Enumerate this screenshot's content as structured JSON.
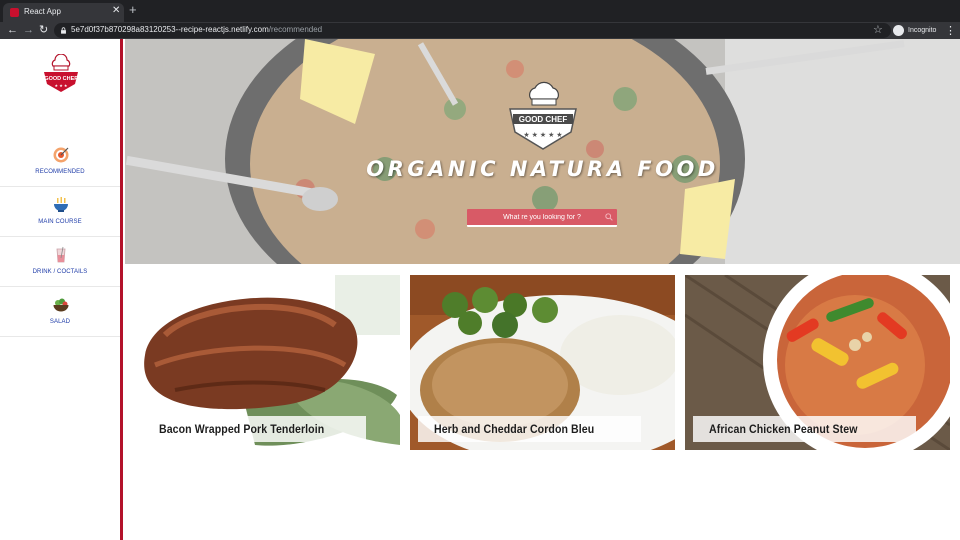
{
  "browser": {
    "tab_title": "React App",
    "tab_close": "✕",
    "new_tab": "+",
    "back": "←",
    "forward": "→",
    "reload": "↻",
    "url_host": "5e7d0f37b870298a83120253--recipe-reactjs.netlify.com",
    "url_path": "/recommended",
    "bookmark": "☆",
    "profile_label": "Incognito",
    "menu": "⋮"
  },
  "sidebar": {
    "logo_text": "GOOD CHEF",
    "items": [
      {
        "label": "RECOMMENDED",
        "icon": "target-icon"
      },
      {
        "label": "MAIN COURSE",
        "icon": "bowl-icon"
      },
      {
        "label": "DRINK / COCTAILS",
        "icon": "drink-icon"
      },
      {
        "label": "SALAD",
        "icon": "salad-icon"
      }
    ]
  },
  "hero": {
    "logo_text": "GOOD CHEF",
    "title": "ORGANIC NATURA FOOD",
    "search_placeholder": "What re you looking for ?"
  },
  "recipes": [
    {
      "title": "Bacon Wrapped Pork Tenderloin"
    },
    {
      "title": "Herb and Cheddar Cordon Bleu"
    },
    {
      "title": "African Chicken Peanut Stew"
    }
  ],
  "colors": {
    "brand_red": "#b3122a",
    "sidebar_label": "#1f3ca8",
    "search_bg": "#d85a66"
  }
}
